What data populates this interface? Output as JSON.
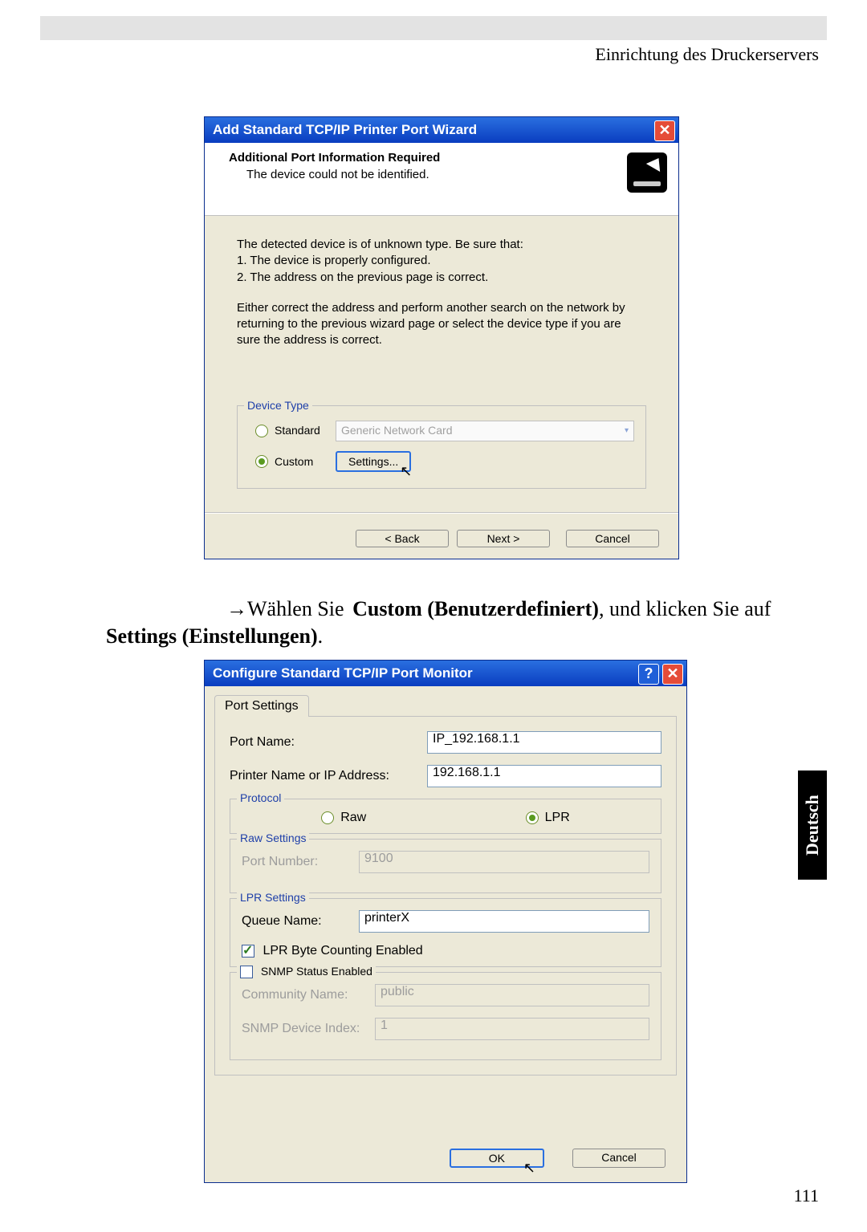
{
  "page": {
    "header": "Einrichtung des Druckerservers",
    "number": "111",
    "side_tab": "Deutsch"
  },
  "instruction": {
    "prefix": "→Wählen Sie ",
    "bold1": "Custom (Benutzerdefiniert)",
    "mid": ", und klicken Sie auf ",
    "bold2": "Settings (Einstellungen)",
    "suffix": "."
  },
  "dialog1": {
    "title": "Add Standard TCP/IP Printer Port Wizard",
    "head_title": "Additional Port Information Required",
    "head_sub": "The device could not be identified.",
    "body1": "The detected device is of unknown type.  Be sure that:",
    "body2": "1.  The device is properly configured.",
    "body3": "2.  The address on the previous page is correct.",
    "body4": "Either correct the address and perform another search on the network by returning to the previous wizard page or select the device type if you are sure the address is correct.",
    "legend": "Device Type",
    "standard_label": "Standard",
    "standard_select": "Generic Network Card",
    "custom_label": "Custom",
    "settings_btn": "Settings...",
    "back_btn": "< Back",
    "next_btn": "Next >",
    "cancel_btn": "Cancel"
  },
  "dialog2": {
    "title": "Configure Standard TCP/IP Port Monitor",
    "tab": "Port Settings",
    "port_name_label": "Port Name:",
    "port_name_value": "IP_192.168.1.1",
    "ip_label": "Printer Name or IP Address:",
    "ip_value": "192.168.1.1",
    "protocol_legend": "Protocol",
    "raw_label": "Raw",
    "lpr_label": "LPR",
    "raw_settings_legend": "Raw Settings",
    "port_number_label": "Port Number:",
    "port_number_value": "9100",
    "lpr_settings_legend": "LPR Settings",
    "queue_label": "Queue Name:",
    "queue_value": "printerX",
    "lpr_byte_label": "LPR Byte Counting Enabled",
    "snmp_legend": "SNMP Status Enabled",
    "community_label": "Community Name:",
    "community_value": "public",
    "snmp_index_label": "SNMP Device Index:",
    "snmp_index_value": "1",
    "ok_btn": "OK",
    "cancel_btn": "Cancel"
  }
}
